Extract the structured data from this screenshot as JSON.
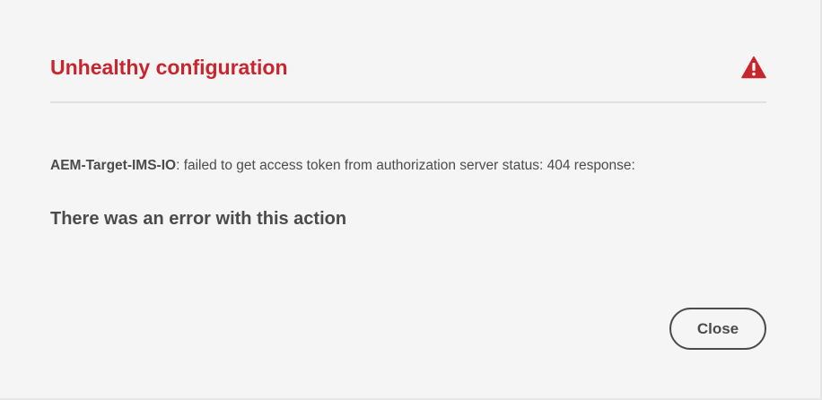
{
  "dialog": {
    "title": "Unhealthy configuration",
    "icon": "alert-triangle-icon",
    "accent_color": "#c9252d",
    "message_source": "AEM-Target-IMS-IO",
    "message_text": ": failed to get access token from authorization server status: 404 response:",
    "error_heading": "There was an error with this action",
    "close_label": "Close"
  }
}
